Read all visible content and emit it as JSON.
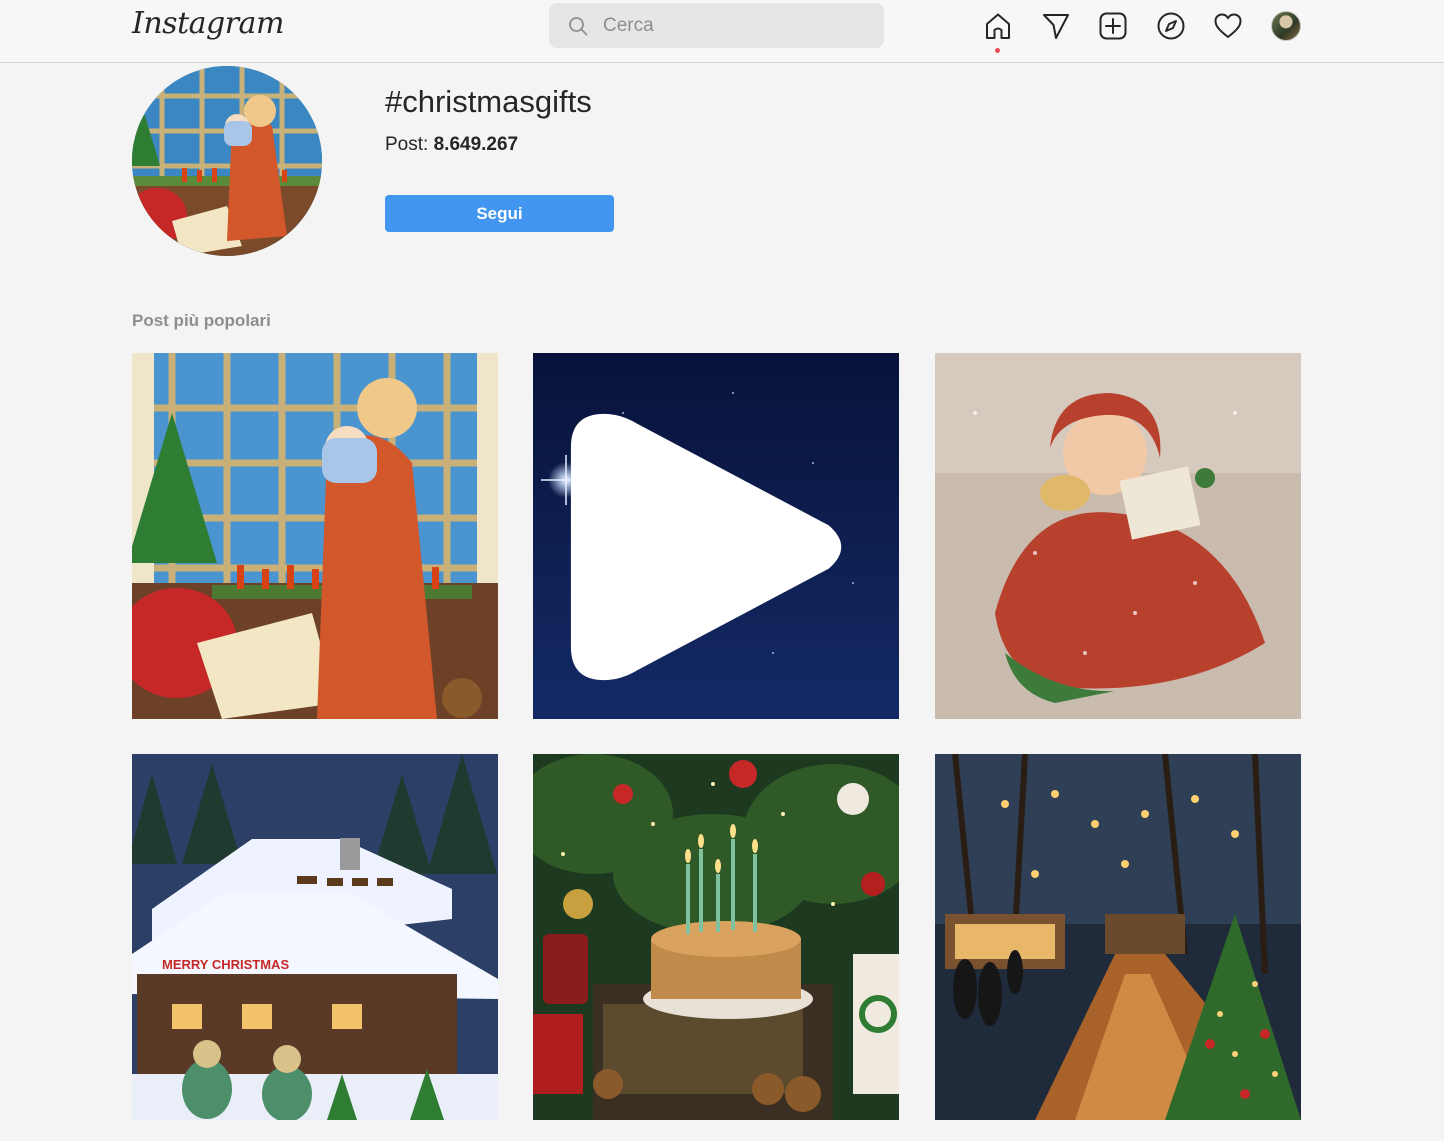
{
  "header": {
    "logo": "Instagram",
    "search_placeholder": "Cerca",
    "icons": [
      "home-icon",
      "direct-icon",
      "new-post-icon",
      "explore-icon",
      "activity-heart-icon",
      "profile-avatar"
    ]
  },
  "hashtag": {
    "title": "#christmasgifts",
    "posts_label": "Post:",
    "posts_count": "8.649.267",
    "follow_label": "Segui"
  },
  "section": {
    "top_posts_label": "Post più popolari"
  },
  "posts": [
    {
      "subject": "girl holding baby at snowy window with candles"
    },
    {
      "subject": "bright star in dark night sky",
      "type": "reel"
    },
    {
      "subject": "vintage girl singing carols with glitter"
    },
    {
      "subject": "snowy log cabin with Santa sleigh",
      "sign": "MERRY CHRISTMAS"
    },
    {
      "subject": "cake with candles under Christmas tree"
    },
    {
      "subject": "Christmas market street at night"
    }
  ],
  "colors": {
    "accent": "#4296f0",
    "notification_dot": "#ed4956",
    "text": "#262626",
    "muted": "#8e8e8e"
  }
}
